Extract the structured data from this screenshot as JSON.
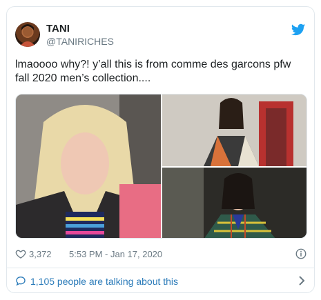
{
  "user": {
    "name": "TANI",
    "handle": "@TANIRICHES"
  },
  "tweet": {
    "text_line1": "lmaoooo why?! y’all this is from comme des garcons pfw",
    "text_line2": "fall 2020 men’s collection...."
  },
  "icons": {
    "bird": "twitter-bird-icon",
    "heart": "heart-icon",
    "info": "info-icon",
    "bubble": "speech-bubble-icon",
    "chevron": "chevron-right-icon"
  },
  "meta": {
    "likes": "3,372",
    "timestamp": "5:53 PM - Jan 17, 2020"
  },
  "footer": {
    "talking": "1,105 people are talking about this"
  },
  "colors": {
    "brand_blue": "#1da1f2",
    "link_blue": "#2b7bb9",
    "muted_gray": "#697882",
    "border": "#e1e8ed"
  }
}
